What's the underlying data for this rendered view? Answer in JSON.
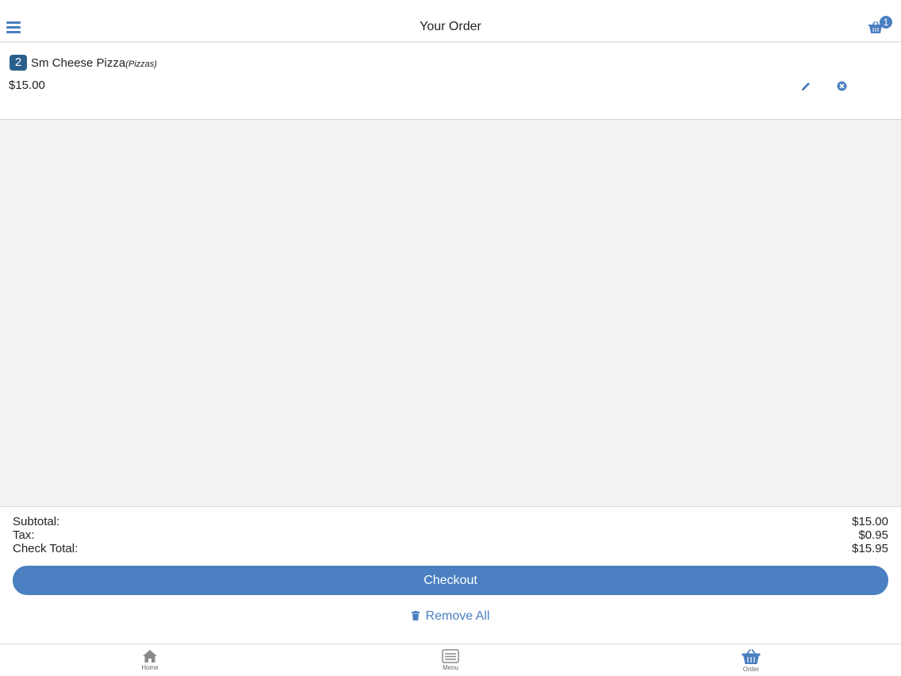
{
  "header": {
    "title": "Your Order",
    "cart_count": "1"
  },
  "order_items": [
    {
      "quantity": "2",
      "name": "Sm Cheese Pizza",
      "category": "(Pizzas)",
      "price": "$15.00"
    }
  ],
  "totals": {
    "subtotal_label": "Subtotal:",
    "subtotal_value": "$15.00",
    "tax_label": "Tax:",
    "tax_value": "$0.95",
    "check_total_label": "Check Total:",
    "check_total_value": "$15.95"
  },
  "actions": {
    "checkout_label": "Checkout",
    "remove_all_label": "Remove All"
  },
  "bottom_nav": {
    "home_label": "Home",
    "menu_label": "Menu",
    "order_label": "Order"
  },
  "colors": {
    "accent": "#4a7fc1",
    "qty_badge": "#2a5f8c",
    "background": "#f2f2f2"
  },
  "icons": {
    "menu": "hamburger-icon",
    "cart": "basket-icon",
    "edit": "pencil-icon",
    "remove": "close-circle-icon",
    "trash": "trash-icon",
    "home": "home-icon",
    "menu_nav": "list-icon",
    "order_nav": "basket-icon"
  }
}
